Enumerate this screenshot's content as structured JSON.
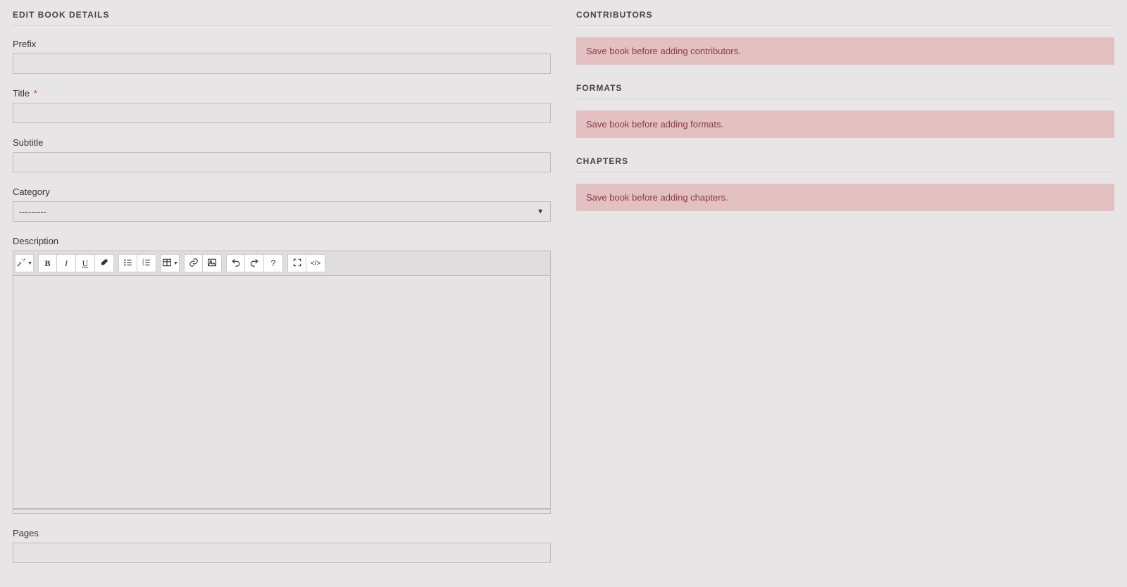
{
  "editSection": {
    "heading": "EDIT BOOK DETAILS",
    "fields": {
      "prefix": {
        "label": "Prefix",
        "value": ""
      },
      "title": {
        "label": "Title",
        "required": "*",
        "value": ""
      },
      "subtitle": {
        "label": "Subtitle",
        "value": ""
      },
      "category": {
        "label": "Category",
        "placeholder": "---------"
      },
      "description": {
        "label": "Description",
        "value": ""
      },
      "pages": {
        "label": "Pages",
        "value": ""
      }
    },
    "toolbar": {
      "magic": "magic",
      "bold": "B",
      "italic": "I",
      "underline": "U",
      "clear": "clear",
      "ul": "ul",
      "ol": "ol",
      "table": "table",
      "link": "link",
      "image": "image",
      "undo": "undo",
      "redo": "redo",
      "help": "?",
      "fullscreen": "fullscreen",
      "code": "</>"
    }
  },
  "contributors": {
    "heading": "CONTRIBUTORS",
    "alert": "Save book before adding contributors."
  },
  "formats": {
    "heading": "FORMATS",
    "alert": "Save book before adding formats."
  },
  "chapters": {
    "heading": "CHAPTERS",
    "alert": "Save book before adding chapters."
  }
}
